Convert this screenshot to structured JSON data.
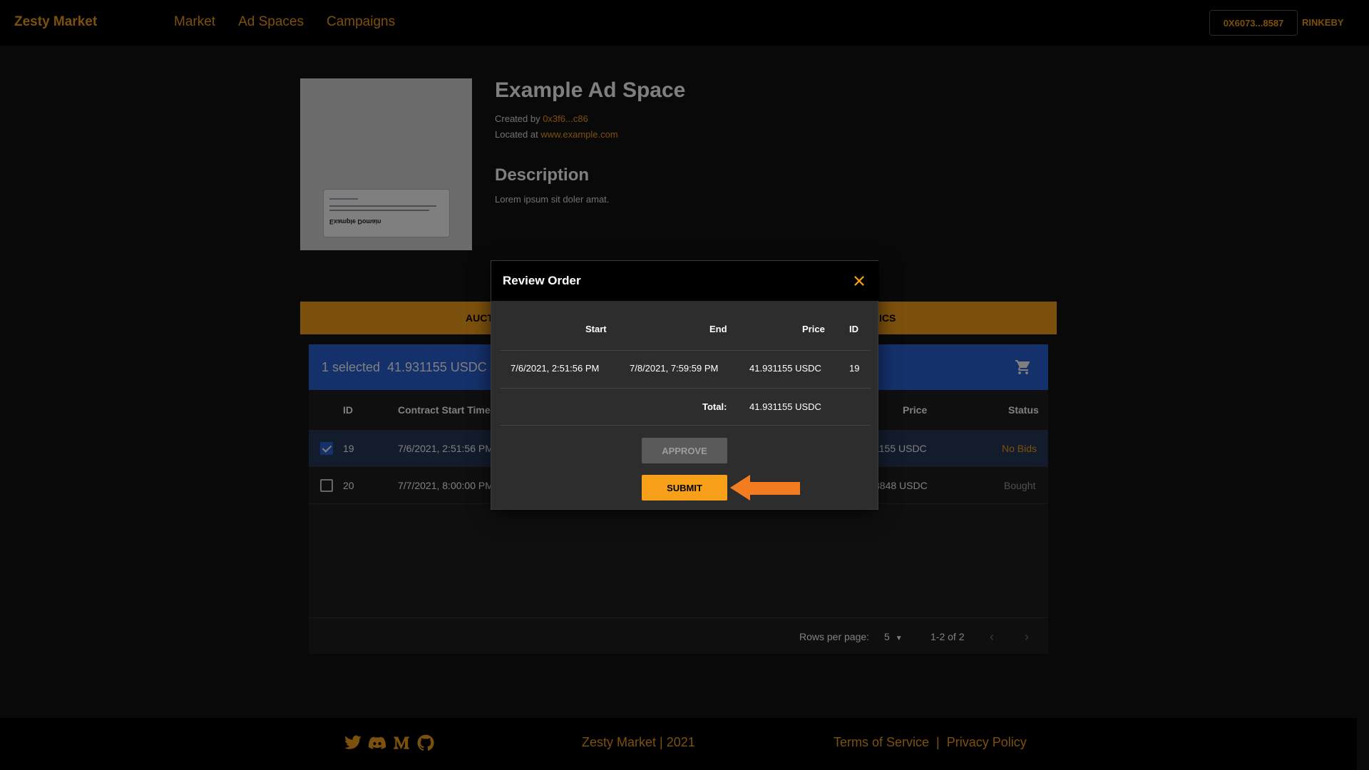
{
  "header": {
    "brand": "Zesty Market",
    "nav": [
      "Market",
      "Ad Spaces",
      "Campaigns"
    ],
    "wallet": "0X6073...8587",
    "network": "RINKEBY"
  },
  "ad_space": {
    "title": "Example Ad Space",
    "created_by_label": "Created by ",
    "created_by_value": "0x3f6...c86",
    "located_at_label": "Located at ",
    "located_at_value": "www.example.com",
    "description_title": "Description",
    "description_text": "Lorem ipsum sit doler amat.",
    "thumbnail_text": "Example Domain"
  },
  "tabs": {
    "left_fragment": "AUCT",
    "right_fragment": "ICS"
  },
  "table": {
    "selected_count": "1 selected",
    "selected_total": "41.931155 USDC",
    "columns": [
      "ID",
      "Contract Start Time",
      "Price",
      "Status"
    ],
    "rows": [
      {
        "id": "19",
        "start": "7/6/2021, 2:51:56 PM",
        "price": "1155 USDC",
        "status": "No Bids",
        "checked": true
      },
      {
        "id": "20",
        "start": "7/7/2021, 8:00:00 PM",
        "price": "3848 USDC",
        "status": "Bought",
        "checked": false
      }
    ],
    "rows_per_page_label": "Rows per page:",
    "rows_per_page_value": "5",
    "pagination": "1-2 of 2"
  },
  "footer": {
    "copyright": "Zesty Market | 2021",
    "terms": "Terms of Service",
    "separator": "|",
    "privacy": "Privacy Policy"
  },
  "modal": {
    "title": "Review Order",
    "columns": {
      "start": "Start",
      "end": "End",
      "price": "Price",
      "id": "ID"
    },
    "order": {
      "start": "7/6/2021, 2:51:56 PM",
      "end": "7/8/2021, 7:59:59 PM",
      "price": "41.931155 USDC",
      "id": "19"
    },
    "total_label": "Total:",
    "total_value": "41.931155 USDC",
    "approve_label": "APPROVE",
    "submit_label": "SUBMIT"
  },
  "colors": {
    "accent": "#f9a01b",
    "selection_blue": "#2a62d6",
    "pointer_arrow": "#f47c20"
  }
}
